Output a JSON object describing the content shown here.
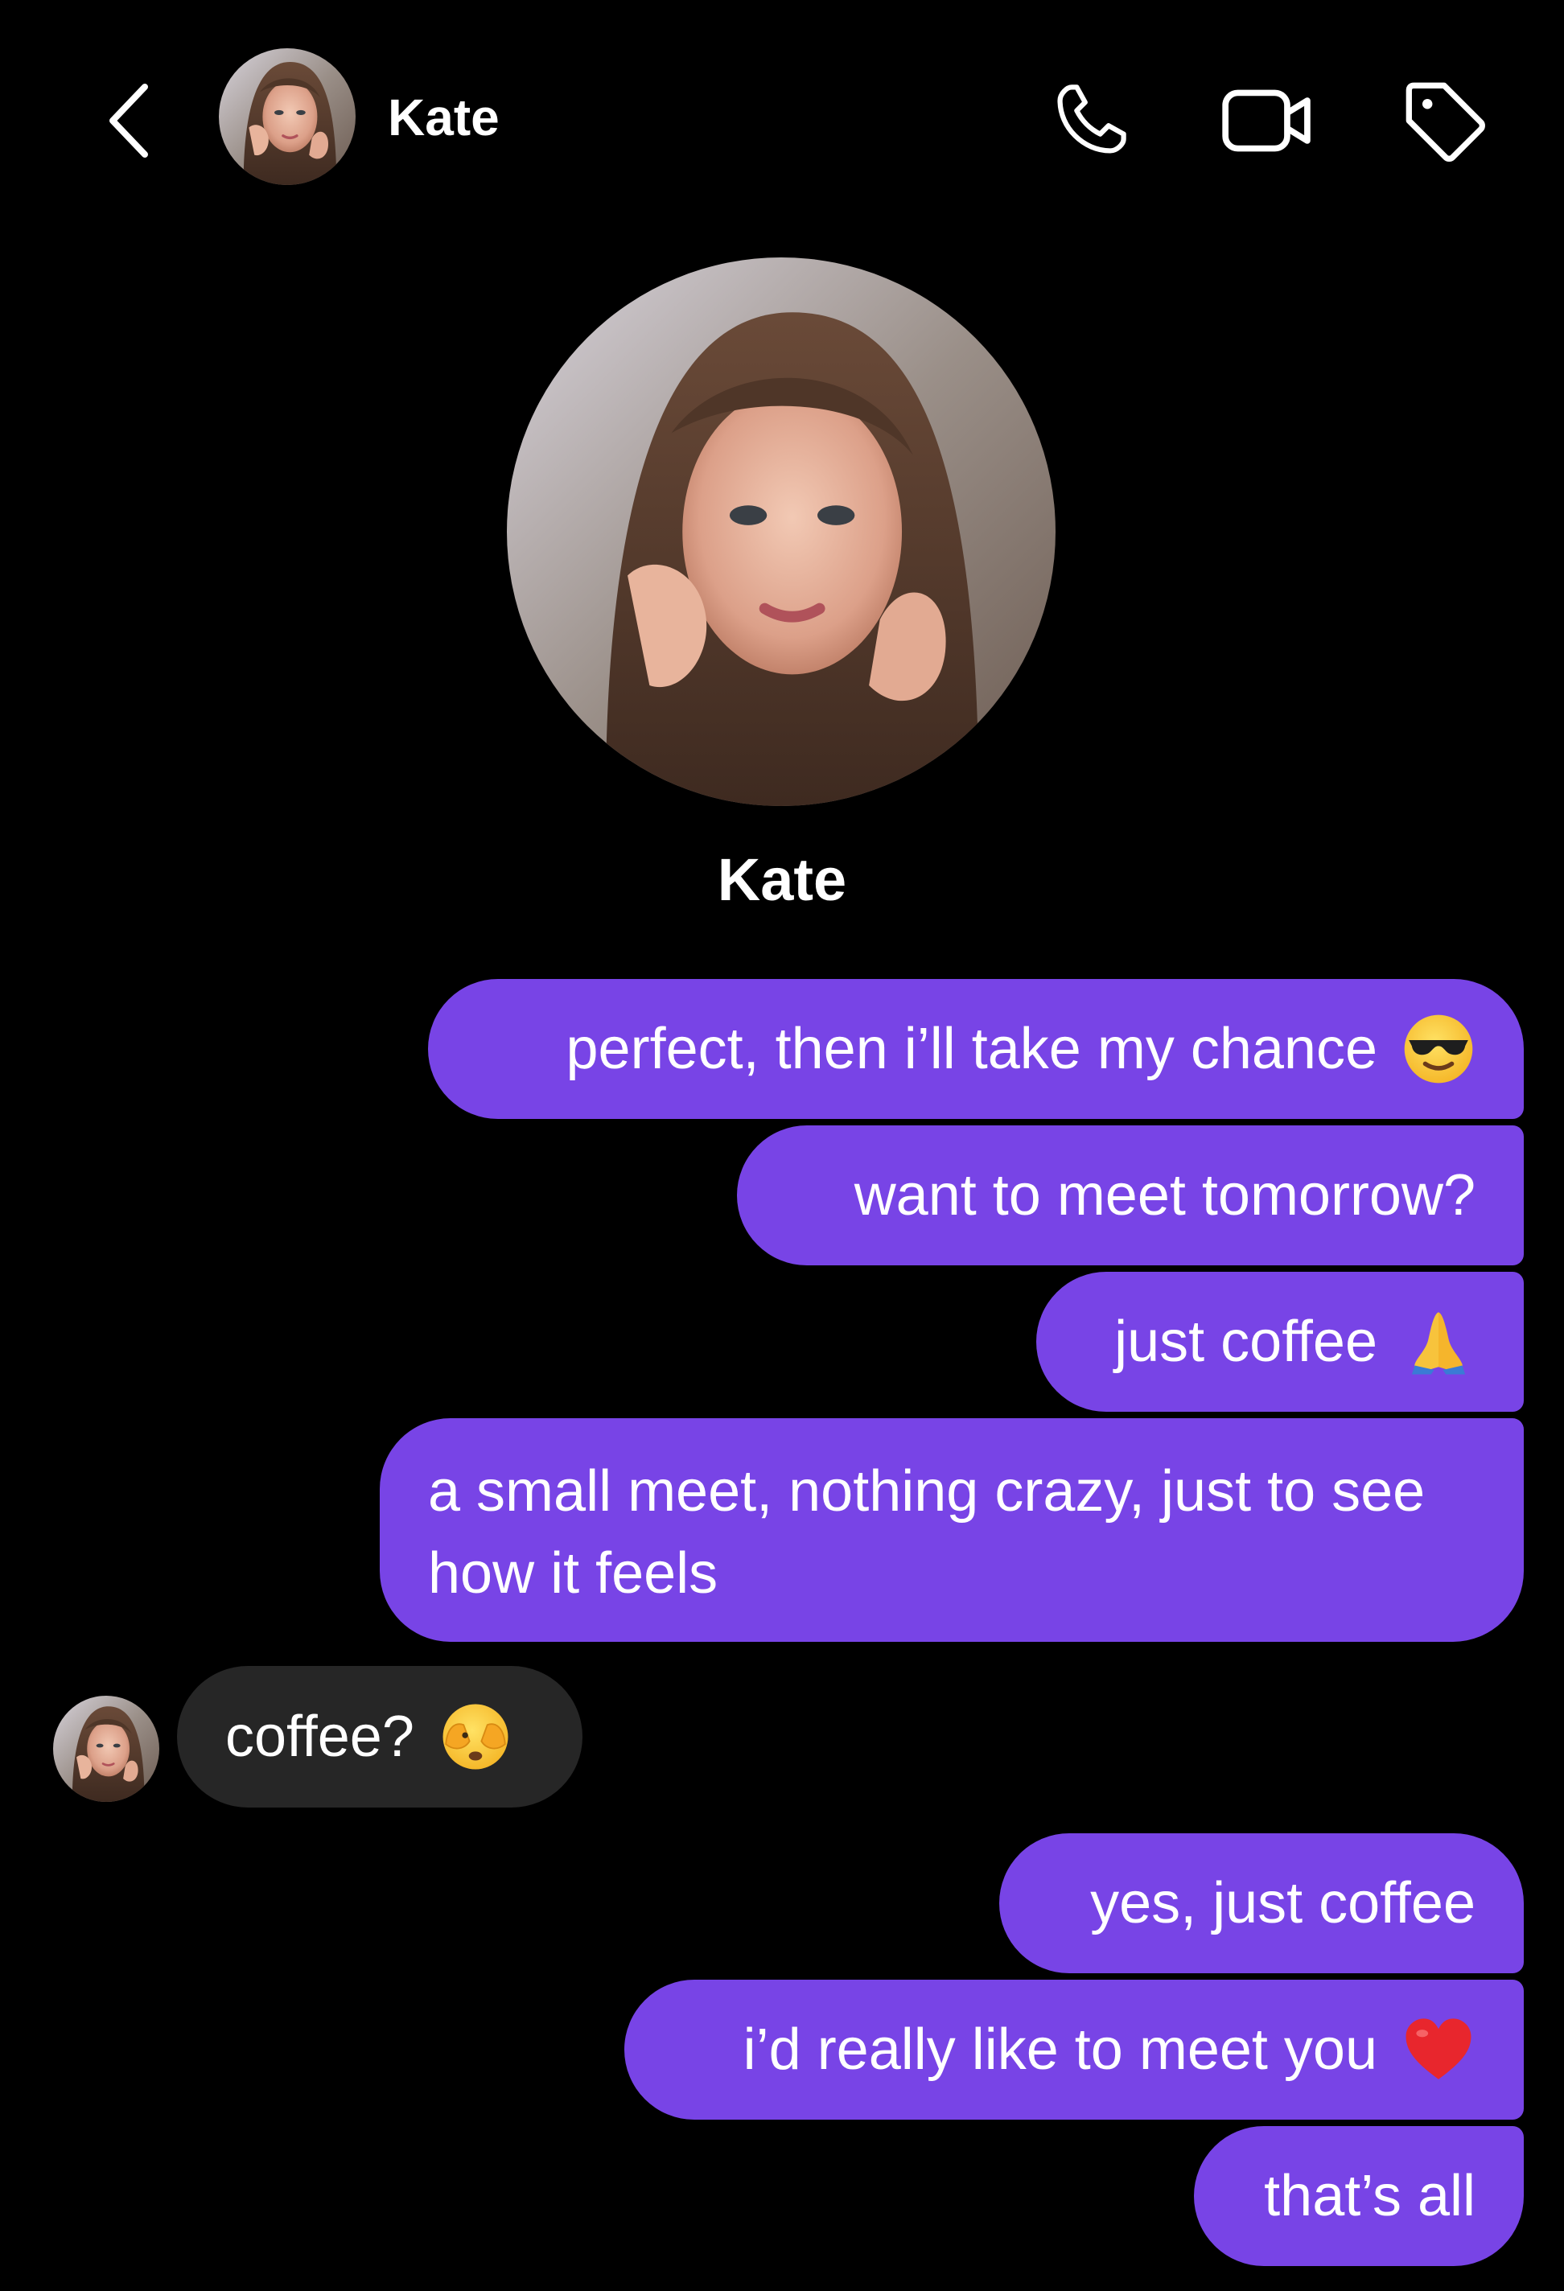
{
  "header": {
    "contact_name": "Kate"
  },
  "profile": {
    "name": "Kate"
  },
  "messages": [
    {
      "text": "perfect, then i’ll take my chance",
      "emoji_icon": "sunglasses-face-icon",
      "direction": "outgoing"
    },
    {
      "text": "want to meet tomorrow?",
      "direction": "outgoing"
    },
    {
      "text": "just coffee",
      "emoji_icon": "folded-hands-icon",
      "direction": "outgoing"
    },
    {
      "text": "a small meet, nothing crazy, just to see how it feels",
      "direction": "outgoing"
    },
    {
      "text": "coffee?",
      "emoji_icon": "peeking-face-icon",
      "direction": "incoming"
    },
    {
      "text": "yes, just coffee",
      "direction": "outgoing"
    },
    {
      "text": "i’d really like to meet you",
      "emoji_icon": "red-heart-icon",
      "direction": "outgoing"
    },
    {
      "text": "that’s all",
      "direction": "outgoing"
    }
  ],
  "colors": {
    "background": "#000000",
    "outgoing_bubble": "#7844e6",
    "incoming_bubble": "#262626",
    "text": "#ffffff"
  }
}
